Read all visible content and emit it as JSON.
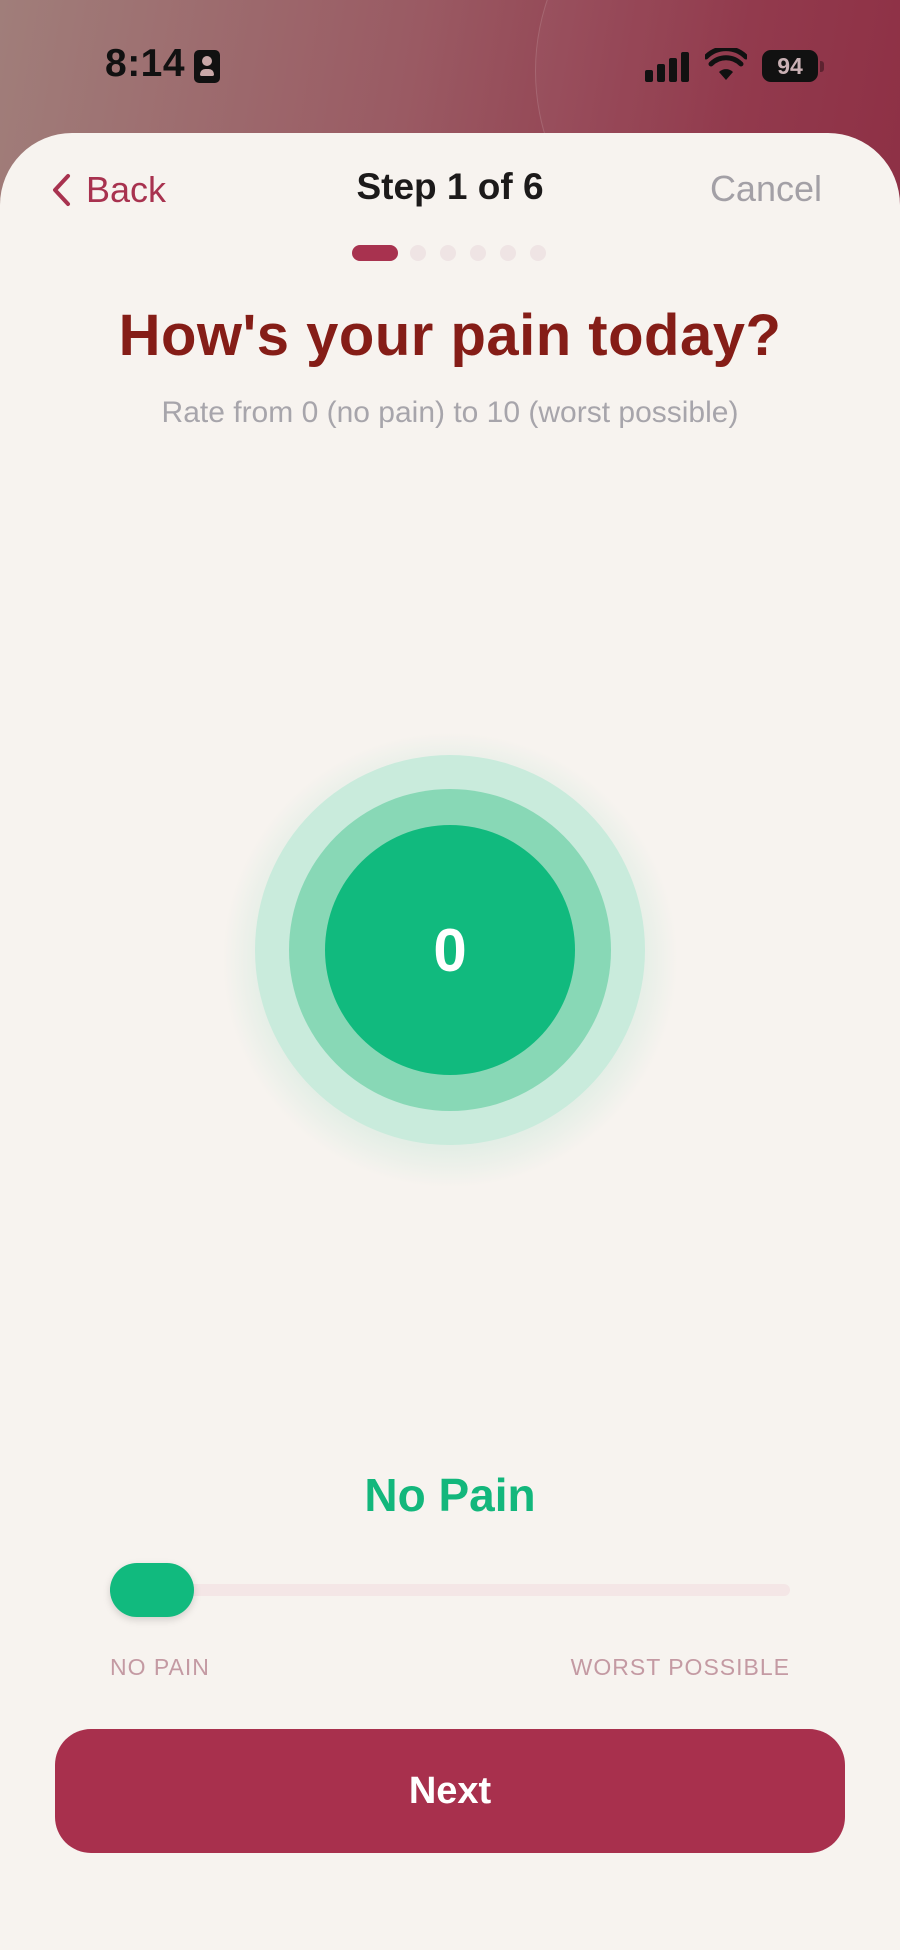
{
  "status_bar": {
    "time": "8:14",
    "battery": "94",
    "icons": [
      "id-card-icon",
      "signal-icon",
      "wifi-icon",
      "battery-icon"
    ]
  },
  "header": {
    "back_label": "Back",
    "step_label": "Step 1 of 6",
    "cancel_label": "Cancel",
    "progress": {
      "current_step": 1,
      "total_steps": 6
    }
  },
  "question": {
    "title": "How's your pain today?",
    "subtitle": "Rate from 0 (no pain) to 10 (worst possible)"
  },
  "pain_dial": {
    "value": "0",
    "color": "#11ba7e"
  },
  "pain_level": {
    "label": "No Pain"
  },
  "slider": {
    "value": 0,
    "min": 0,
    "max": 10,
    "min_label": "NO PAIN",
    "max_label": "WORST POSSIBLE"
  },
  "footer": {
    "next_label": "Next"
  },
  "colors": {
    "accent": "#a8324f",
    "title": "#851d17",
    "success": "#11ba7e",
    "background": "#f7f3ef"
  }
}
